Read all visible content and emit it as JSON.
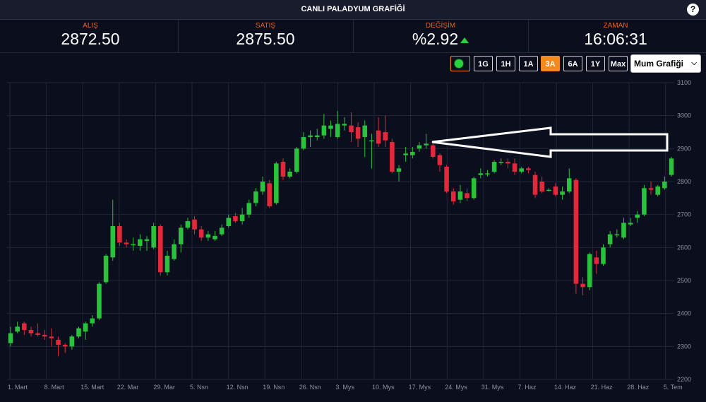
{
  "window": {
    "title": "CANLI PALADYUM GRAFİĞİ",
    "help_label": "?"
  },
  "stats": {
    "bid": {
      "label": "ALIŞ",
      "value": "2872.50"
    },
    "ask": {
      "label": "SATIŞ",
      "value": "2875.50"
    },
    "change": {
      "label": "DEĞİŞİM",
      "value": "%2.92"
    },
    "time": {
      "label": "ZAMAN",
      "value": "16:06:31"
    }
  },
  "controls": {
    "ranges": [
      "1G",
      "1H",
      "1A",
      "3A",
      "6A",
      "1Y",
      "Max"
    ],
    "active_range": "3A",
    "chart_type": "Mum Grafiği",
    "accent": "#f28a1f",
    "live_color": "#2ad13c"
  },
  "chart_data": {
    "type": "candlestick",
    "up_color": "#2ac13c",
    "down_color": "#e2283a",
    "ylim": [
      2200,
      3100
    ],
    "yticks": [
      2200,
      2300,
      2400,
      2500,
      2600,
      2700,
      2800,
      2900,
      3000,
      3100
    ],
    "xticks": [
      "1. Mart",
      "8. Mart",
      "15. Mart",
      "22. Mar",
      "29. Mar",
      "5. Nsn",
      "12. Nsn",
      "19. Nsn",
      "26. Nsn",
      "3. Mys",
      "10. Mys",
      "17. Mys",
      "24. Mys",
      "31. Mys",
      "7. Haz",
      "14. Haz",
      "21. Haz",
      "28. Haz",
      "5. Tem"
    ],
    "candles": [
      [
        2310,
        2340,
        2300,
        2360
      ],
      [
        2345,
        2360,
        2340,
        2375
      ],
      [
        2370,
        2350,
        2335,
        2375
      ],
      [
        2350,
        2340,
        2330,
        2360
      ],
      [
        2340,
        2335,
        2330,
        2370
      ],
      [
        2335,
        2330,
        2320,
        2350
      ],
      [
        2330,
        2325,
        2300,
        2355
      ],
      [
        2320,
        2305,
        2270,
        2330
      ],
      [
        2305,
        2300,
        2280,
        2310
      ],
      [
        2300,
        2330,
        2290,
        2335
      ],
      [
        2330,
        2355,
        2325,
        2360
      ],
      [
        2345,
        2370,
        2320,
        2375
      ],
      [
        2370,
        2385,
        2360,
        2395
      ],
      [
        2385,
        2490,
        2380,
        2495
      ],
      [
        2495,
        2575,
        2490,
        2580
      ],
      [
        2570,
        2665,
        2560,
        2745
      ],
      [
        2665,
        2615,
        2605,
        2675
      ],
      [
        2615,
        2610,
        2600,
        2625
      ],
      [
        2610,
        2610,
        2590,
        2630
      ],
      [
        2605,
        2625,
        2590,
        2640
      ],
      [
        2620,
        2625,
        2590,
        2635
      ],
      [
        2600,
        2665,
        2595,
        2675
      ],
      [
        2665,
        2525,
        2515,
        2670
      ],
      [
        2525,
        2575,
        2515,
        2590
      ],
      [
        2565,
        2610,
        2560,
        2625
      ],
      [
        2610,
        2660,
        2585,
        2670
      ],
      [
        2660,
        2680,
        2655,
        2690
      ],
      [
        2685,
        2655,
        2640,
        2695
      ],
      [
        2655,
        2630,
        2620,
        2665
      ],
      [
        2630,
        2640,
        2620,
        2650
      ],
      [
        2625,
        2635,
        2620,
        2650
      ],
      [
        2640,
        2660,
        2635,
        2670
      ],
      [
        2665,
        2690,
        2660,
        2700
      ],
      [
        2695,
        2680,
        2675,
        2705
      ],
      [
        2680,
        2700,
        2670,
        2720
      ],
      [
        2700,
        2735,
        2690,
        2745
      ],
      [
        2735,
        2770,
        2725,
        2780
      ],
      [
        2770,
        2800,
        2760,
        2815
      ],
      [
        2795,
        2725,
        2720,
        2805
      ],
      [
        2735,
        2855,
        2730,
        2860
      ],
      [
        2860,
        2815,
        2805,
        2870
      ],
      [
        2815,
        2830,
        2810,
        2840
      ],
      [
        2830,
        2900,
        2825,
        2905
      ],
      [
        2900,
        2935,
        2895,
        2950
      ],
      [
        2935,
        2940,
        2905,
        2955
      ],
      [
        2935,
        2940,
        2925,
        2960
      ],
      [
        2940,
        2970,
        2930,
        3005
      ],
      [
        2960,
        2970,
        2935,
        2985
      ],
      [
        2935,
        2975,
        2930,
        3015
      ],
      [
        2970,
        2975,
        2955,
        2995
      ],
      [
        2970,
        2950,
        2920,
        3010
      ],
      [
        2965,
        2930,
        2905,
        2980
      ],
      [
        2935,
        2970,
        2875,
        2985
      ],
      [
        2925,
        2925,
        2840,
        2945
      ],
      [
        2955,
        2915,
        2905,
        2995
      ],
      [
        2950,
        2925,
        2905,
        3000
      ],
      [
        2920,
        2830,
        2825,
        2930
      ],
      [
        2830,
        2840,
        2800,
        2850
      ],
      [
        2880,
        2885,
        2860,
        2905
      ],
      [
        2880,
        2890,
        2870,
        2905
      ],
      [
        2900,
        2910,
        2890,
        2920
      ],
      [
        2910,
        2915,
        2900,
        2945
      ],
      [
        2910,
        2875,
        2870,
        2920
      ],
      [
        2880,
        2850,
        2830,
        2885
      ],
      [
        2845,
        2770,
        2765,
        2850
      ],
      [
        2770,
        2740,
        2730,
        2780
      ],
      [
        2745,
        2770,
        2735,
        2790
      ],
      [
        2765,
        2750,
        2740,
        2780
      ],
      [
        2750,
        2810,
        2745,
        2815
      ],
      [
        2820,
        2825,
        2810,
        2840
      ],
      [
        2825,
        2825,
        2815,
        2835
      ],
      [
        2830,
        2860,
        2825,
        2865
      ],
      [
        2860,
        2860,
        2850,
        2870
      ],
      [
        2860,
        2855,
        2840,
        2870
      ],
      [
        2855,
        2830,
        2820,
        2870
      ],
      [
        2830,
        2840,
        2825,
        2845
      ],
      [
        2840,
        2835,
        2825,
        2845
      ],
      [
        2820,
        2760,
        2750,
        2830
      ],
      [
        2800,
        2770,
        2765,
        2815
      ],
      [
        2775,
        2775,
        2770,
        2780
      ],
      [
        2785,
        2760,
        2755,
        2795
      ],
      [
        2760,
        2770,
        2745,
        2785
      ],
      [
        2770,
        2810,
        2765,
        2840
      ],
      [
        2805,
        2490,
        2460,
        2810
      ],
      [
        2490,
        2480,
        2455,
        2510
      ],
      [
        2480,
        2580,
        2470,
        2585
      ],
      [
        2570,
        2550,
        2520,
        2590
      ],
      [
        2550,
        2600,
        2545,
        2610
      ],
      [
        2610,
        2640,
        2600,
        2650
      ],
      [
        2640,
        2640,
        2630,
        2655
      ],
      [
        2630,
        2675,
        2625,
        2690
      ],
      [
        2670,
        2675,
        2665,
        2690
      ],
      [
        2690,
        2700,
        2675,
        2710
      ],
      [
        2700,
        2780,
        2695,
        2790
      ],
      [
        2780,
        2775,
        2760,
        2800
      ],
      [
        2760,
        2785,
        2755,
        2790
      ],
      [
        2780,
        2800,
        2775,
        2815
      ],
      [
        2820,
        2870,
        2815,
        2875
      ]
    ]
  }
}
